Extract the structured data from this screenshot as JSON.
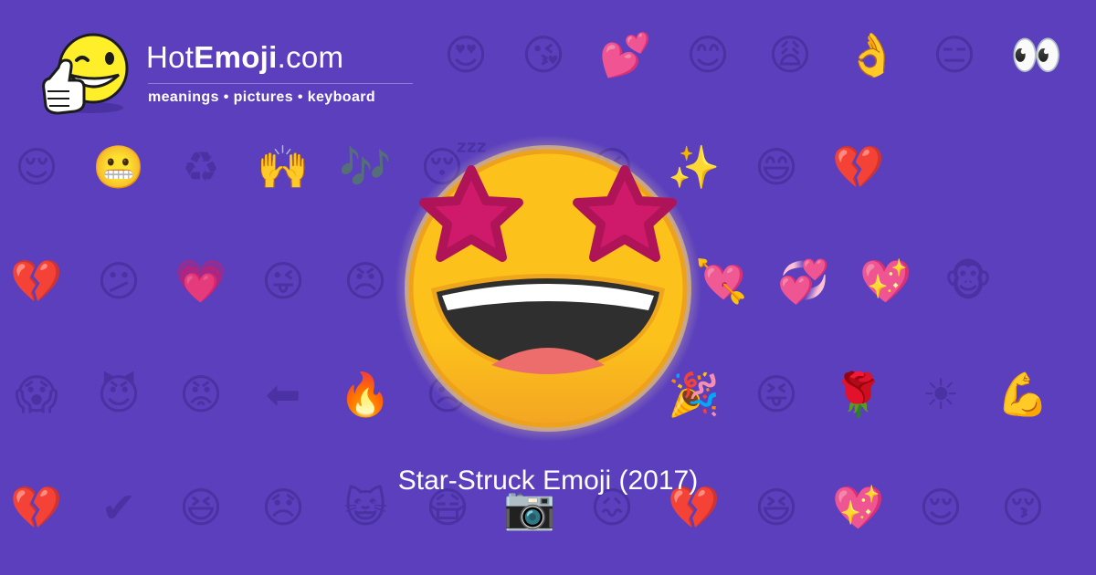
{
  "site": {
    "name_prefix": "Hot",
    "name_bold": "Emoji",
    "name_suffix": ".com",
    "tagline": "meanings • pictures • keyboard"
  },
  "hero": {
    "icon": "star-struck-face-icon",
    "caption": "Star-Struck Emoji (2017)"
  },
  "background": {
    "icon_color": "#4b32a3",
    "rows": [
      [
        "😍",
        "😘",
        "💕",
        "😊",
        "😩",
        "👌",
        "😑",
        "👀",
        "😏"
      ],
      [
        "😌",
        "😬",
        "♻",
        "🙌",
        "🎶",
        "😴",
        "😞",
        "😆",
        "✨",
        "😄",
        "💔"
      ],
      [
        "💔",
        "😕",
        "💗",
        "😜",
        "😠",
        "💘",
        "💞",
        "💖",
        "🐵"
      ],
      [
        "😱",
        "😈",
        "😡",
        "⬅",
        "🔥",
        "😠",
        "🎉",
        "😝",
        "🌹",
        "☀",
        "💪"
      ],
      [
        "💔",
        "✔",
        "😆",
        "😞",
        "😺",
        "😷",
        "📷",
        "😖",
        "💔",
        "😆",
        "💖",
        "😌",
        "😚"
      ]
    ]
  },
  "colors": {
    "background": "#5b3fbd",
    "face_yellow": "#fcc21b",
    "face_orange": "#f4a522",
    "star_magenta": "#cf1a6b",
    "star_outline": "#ae1457",
    "mouth_dark": "#2f2f2f",
    "tongue": "#ed6c6c"
  }
}
